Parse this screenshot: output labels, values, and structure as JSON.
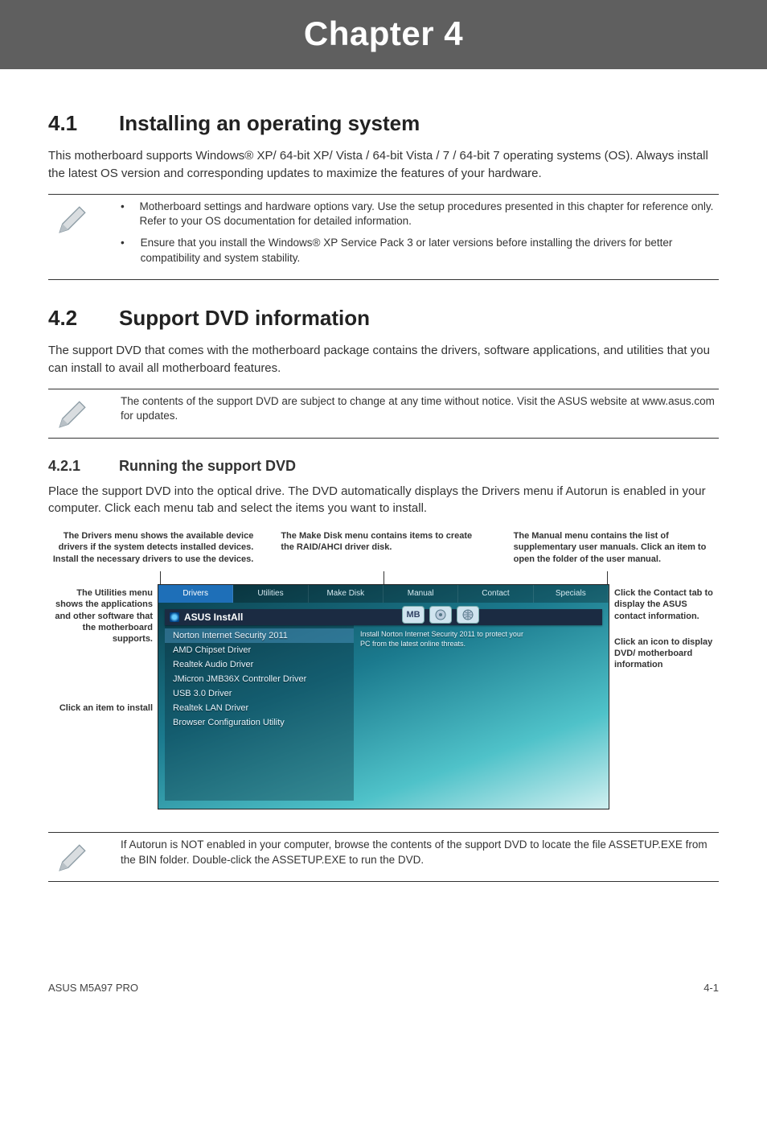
{
  "banner": "Chapter 4",
  "sections": {
    "s41": {
      "num": "4.1",
      "title": "Installing an operating system",
      "body": "This motherboard supports Windows® XP/ 64-bit XP/ Vista / 64-bit Vista / 7 / 64-bit 7 operating systems (OS). Always install the latest OS version and corresponding updates to maximize the features of your hardware.",
      "note": {
        "b1": "Motherboard settings and hardware options vary. Use the setup procedures presented in this chapter for reference only. Refer to your OS documentation for detailed information.",
        "b2": "Ensure that you install the Windows® XP Service Pack 3 or later versions before installing the drivers for better compatibility and system stability."
      }
    },
    "s42": {
      "num": "4.2",
      "title": "Support DVD information",
      "body": "The support DVD that comes with the motherboard package contains the drivers, software applications, and utilities that you can install to avail all motherboard features.",
      "note": "The contents of the support DVD are subject to change at any time without notice. Visit the ASUS website at www.asus.com for updates."
    },
    "s421": {
      "num": "4.2.1",
      "title": "Running the support DVD",
      "body": "Place the support DVD into the optical drive. The DVD automatically displays the Drivers menu if Autorun is enabled in your computer. Click each menu tab and select the items you want to install."
    }
  },
  "callouts": {
    "top1": "The Drivers menu shows the available device drivers if the system detects installed devices. Install the necessary drivers to use the devices.",
    "top2": "The Make Disk menu contains items to create the RAID/AHCI driver disk.",
    "top3": "The Manual menu contains the list of supplementary user manuals. Click an item to open the folder of the user manual.",
    "left1": "The Utilities menu shows the applications and other software that the motherboard supports.",
    "left2": "Click an item to install",
    "right1": "Click the Contact tab to display the ASUS contact information.",
    "right2": "Click an icon to display DVD/ motherboard information"
  },
  "dvd": {
    "tabs": [
      "Drivers",
      "Utilities",
      "Make Disk",
      "Manual",
      "Contact",
      "Specials"
    ],
    "install_label": "ASUS InstAll",
    "drivers": [
      "Norton Internet Security 2011",
      "AMD Chipset Driver",
      "Realtek Audio Driver",
      "JMicron JMB36X Controller Driver",
      "USB 3.0 Driver",
      "Realtek LAN Driver",
      "Browser Configuration Utility"
    ],
    "mb_label": "MB",
    "desc_l1": "Install Norton Internet Security 2011 to protect your",
    "desc_l2": "PC from the latest online threats."
  },
  "bottom_note": "If Autorun is NOT enabled in your computer, browse the contents of the support DVD to locate the file ASSETUP.EXE from the BIN folder. Double-click the ASSETUP.EXE to run the DVD.",
  "footer": {
    "left": "ASUS M5A97 PRO",
    "right": "4-1"
  }
}
